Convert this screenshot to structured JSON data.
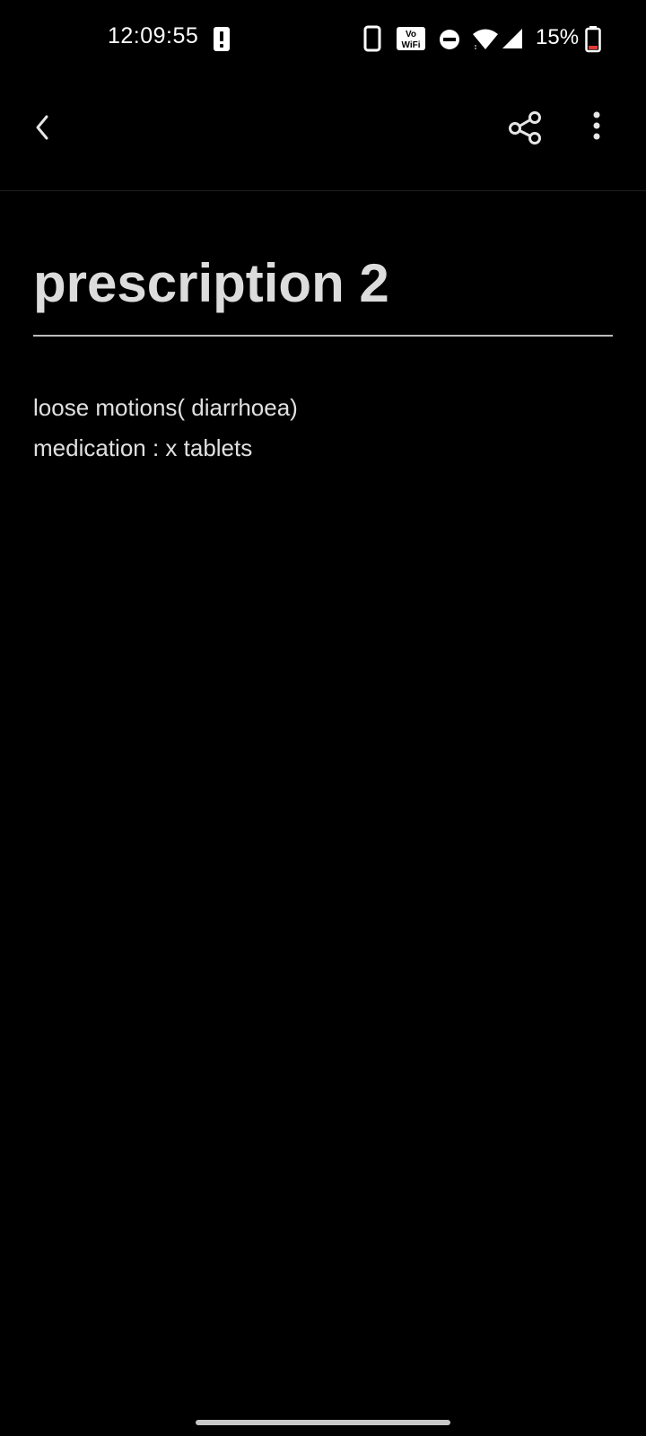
{
  "status_bar": {
    "time": "12:09:55",
    "battery_percent": "15%",
    "icons": [
      "alert-icon",
      "phone-icon",
      "vowifi-icon",
      "dnd-icon",
      "wifi-icon",
      "signal-icon",
      "battery-icon"
    ],
    "vowifi_text_top": "Vo",
    "vowifi_text_bottom": "WiFi",
    "battery_low_color": "#e53935"
  },
  "toolbar": {
    "back_icon": "chevron-left-icon",
    "share_icon": "share-icon",
    "more_icon": "more-vertical-icon"
  },
  "note": {
    "title": "prescription 2",
    "lines": [
      "loose motions( diarrhoea)",
      "medication : x tablets"
    ]
  },
  "colors": {
    "background": "#000000",
    "title": "#dcdcdc",
    "body": "#e0e0e0",
    "divider": "#bdbdbd"
  }
}
